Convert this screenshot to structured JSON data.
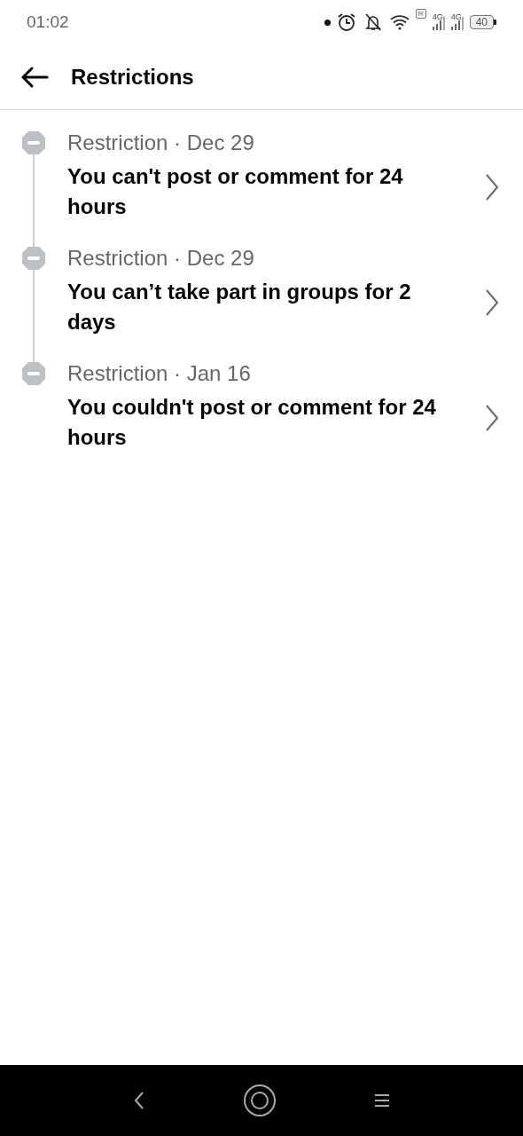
{
  "status_bar": {
    "time": "01:02",
    "roaming": "R",
    "networks": [
      "4G",
      "4G"
    ],
    "battery": "40"
  },
  "header": {
    "title": "Restrictions"
  },
  "restrictions": [
    {
      "meta": "Restriction · Dec 29",
      "title": "You can't post or comment for 24 hours"
    },
    {
      "meta": "Restriction · Dec 29",
      "title": "You can’t take part in groups for 2 days"
    },
    {
      "meta": "Restriction · Jan 16",
      "title": "You couldn't post or comment for 24 hours"
    }
  ]
}
